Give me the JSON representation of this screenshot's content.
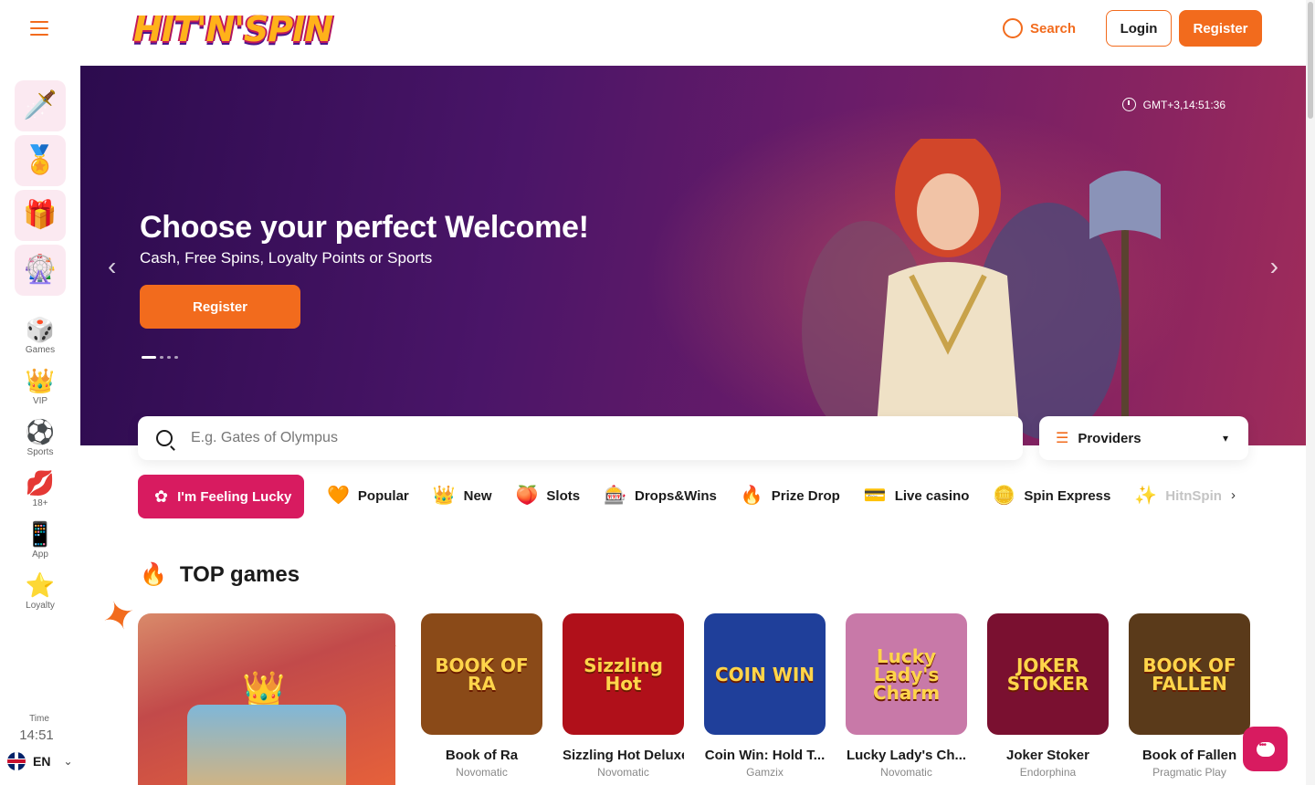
{
  "header": {
    "logo_text": "HIT'N'SPIN",
    "search_label": "Search",
    "login_label": "Login",
    "register_label": "Register"
  },
  "sidebar": {
    "promo_tiles": [
      {
        "icon": "sword-icon",
        "glyph": "🗡️"
      },
      {
        "icon": "medal-icon",
        "glyph": "🏅"
      },
      {
        "icon": "gift-icon",
        "glyph": "🎁"
      },
      {
        "icon": "wheel-icon",
        "glyph": "🎡"
      }
    ],
    "nav": [
      {
        "label": "Games",
        "icon": "dice-icon",
        "glyph": "🎲"
      },
      {
        "label": "VIP",
        "icon": "crown-icon",
        "glyph": "👑"
      },
      {
        "label": "Sports",
        "icon": "ball-icon",
        "glyph": "⚽"
      },
      {
        "label": "18+",
        "icon": "lips-icon",
        "glyph": "💋"
      },
      {
        "label": "App",
        "icon": "phone-icon",
        "glyph": "📱"
      },
      {
        "label": "Loyalty",
        "icon": "star-icon",
        "glyph": "⭐"
      }
    ],
    "time_label": "Time",
    "time_value": "14:51",
    "language": "EN"
  },
  "hero": {
    "title": "Choose your perfect Welcome!",
    "subtitle": "Cash, Free Spins, Loyalty Points or Sports",
    "cta_label": "Register",
    "clock": "GMT+3,14:51:36",
    "slides": 4,
    "active_slide": 1
  },
  "search": {
    "placeholder": "E.g. Gates of Olympus",
    "providers_label": "Providers"
  },
  "categories": {
    "lucky_label": "I'm Feeling Lucky",
    "items": [
      {
        "label": "Popular",
        "icon": "heart-icon",
        "glyph": "🧡"
      },
      {
        "label": "New",
        "icon": "crown-icon",
        "glyph": "👑"
      },
      {
        "label": "Slots",
        "icon": "fruit-icon",
        "glyph": "🍑"
      },
      {
        "label": "Drops&Wins",
        "icon": "drops-wins-icon",
        "glyph": "🎰"
      },
      {
        "label": "Prize Drop",
        "icon": "fire-drop-icon",
        "glyph": "🔥"
      },
      {
        "label": "Live casino",
        "icon": "cards-icon",
        "glyph": "💳"
      },
      {
        "label": "Spin Express",
        "icon": "coin-icon",
        "glyph": "🪙"
      },
      {
        "label": "HitnSpin",
        "icon": "hitnspin-icon",
        "glyph": "✨"
      }
    ]
  },
  "top_games": {
    "title": "TOP games",
    "games": [
      {
        "name": "Book of Ra",
        "provider": "Novomatic",
        "art": "BOOK OF RA",
        "bg": "#8a4a18"
      },
      {
        "name": "Sizzling Hot Deluxe",
        "provider": "Novomatic",
        "art": "Sizzling Hot",
        "bg": "#b0101a"
      },
      {
        "name": "Coin Win: Hold T...",
        "provider": "Gamzix",
        "art": "COIN WIN",
        "bg": "#1f3f9a"
      },
      {
        "name": "Lucky Lady's Ch...",
        "provider": "Novomatic",
        "art": "Lucky Lady's Charm",
        "bg": "#c879a8"
      },
      {
        "name": "Joker Stoker",
        "provider": "Endorphina",
        "art": "JOKER STOKER",
        "bg": "#7a1030"
      },
      {
        "name": "Book of Fallen",
        "provider": "Pragmatic Play",
        "art": "BOOK OF FALLEN",
        "bg": "#5a3a1a"
      }
    ]
  }
}
